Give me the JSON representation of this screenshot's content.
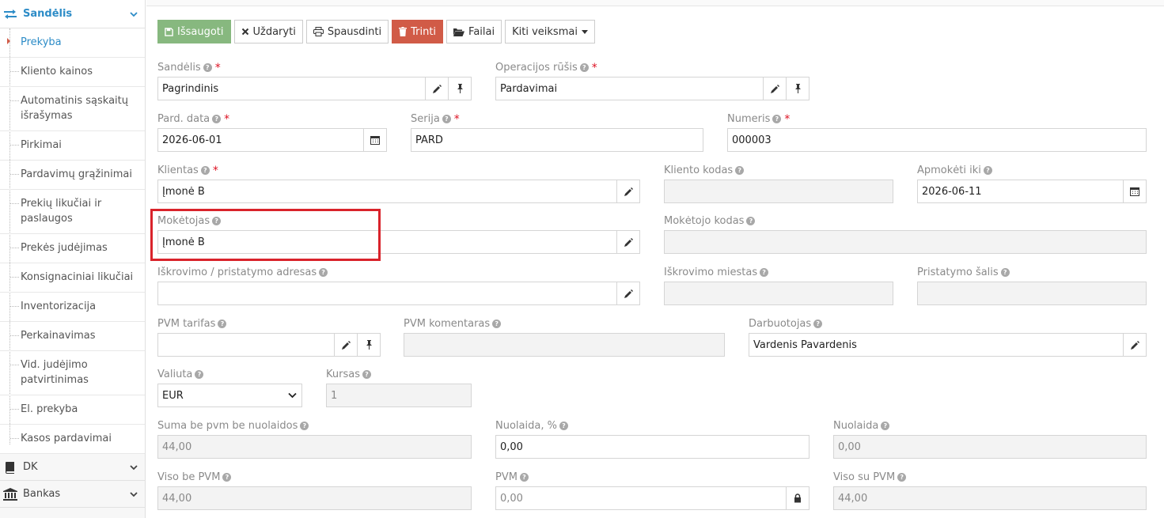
{
  "sidebar": {
    "section": "Sandėlis",
    "items": [
      "Prekyba",
      "Kliento kainos",
      "Automatinis sąskaitų išrašymas",
      "Pirkimai",
      "Pardavimų grąžinimai",
      "Prekių likučiai ir paslaugos",
      "Prekės judėjimas",
      "Konsignaciniai likučiai",
      "Inventorizacija",
      "Perkainavimas",
      "Vid. judėjimo patvirtinimas",
      "El. prekyba",
      "Kasos pardavimai"
    ],
    "bottom": [
      "DK",
      "Bankas"
    ]
  },
  "toolbar": {
    "save": "Išsaugoti",
    "close": "Uždaryti",
    "print": "Spausdinti",
    "delete": "Trinti",
    "files": "Failai",
    "more": "Kiti veiksmai"
  },
  "form": {
    "sandelis": {
      "label": "Sandėlis",
      "value": "Pagrindinis"
    },
    "operacija": {
      "label": "Operacijos rūšis",
      "value": "Pardavimai"
    },
    "data": {
      "label": "Pard. data",
      "value": "2026-06-01"
    },
    "serija": {
      "label": "Serija",
      "value": "PARD"
    },
    "numeris": {
      "label": "Numeris",
      "value": "000003"
    },
    "klientas": {
      "label": "Klientas",
      "value": "Įmonė B"
    },
    "kliento_kodas": {
      "label": "Kliento kodas",
      "value": ""
    },
    "apmoketi": {
      "label": "Apmokėti iki",
      "value": "2026-06-11"
    },
    "moketojas": {
      "label": "Mokėtojas",
      "value": "Įmonė B"
    },
    "moketojo_kodas": {
      "label": "Mokėtojo kodas",
      "value": ""
    },
    "adresas": {
      "label": "Iškrovimo / pristatymo adresas",
      "value": ""
    },
    "miestas": {
      "label": "Iškrovimo miestas",
      "value": ""
    },
    "salis": {
      "label": "Pristatymo šalis",
      "value": ""
    },
    "pvm_tarifas": {
      "label": "PVM tarifas",
      "value": ""
    },
    "pvm_komentaras": {
      "label": "PVM komentaras",
      "value": ""
    },
    "darbuotojas": {
      "label": "Darbuotojas",
      "value": "Vardenis Pavardenis"
    },
    "valiuta": {
      "label": "Valiuta",
      "value": "EUR"
    },
    "kursas": {
      "label": "Kursas",
      "value": "1"
    },
    "suma": {
      "label": "Suma be pvm be nuolaidos",
      "value": "44,00"
    },
    "nuolaida_proc": {
      "label": "Nuolaida, %",
      "value": "0,00"
    },
    "nuolaida": {
      "label": "Nuolaida",
      "value": "0,00"
    },
    "viso_be_pvm": {
      "label": "Viso be PVM",
      "value": "44,00"
    },
    "pvm": {
      "label": "PVM",
      "value": "0,00"
    },
    "viso_su_pvm": {
      "label": "Viso su PVM",
      "value": "44,00"
    }
  },
  "colors": {
    "accent": "#2d8cc7",
    "success": "#87b87f",
    "danger": "#d15b47",
    "highlight": "#d9232b"
  }
}
